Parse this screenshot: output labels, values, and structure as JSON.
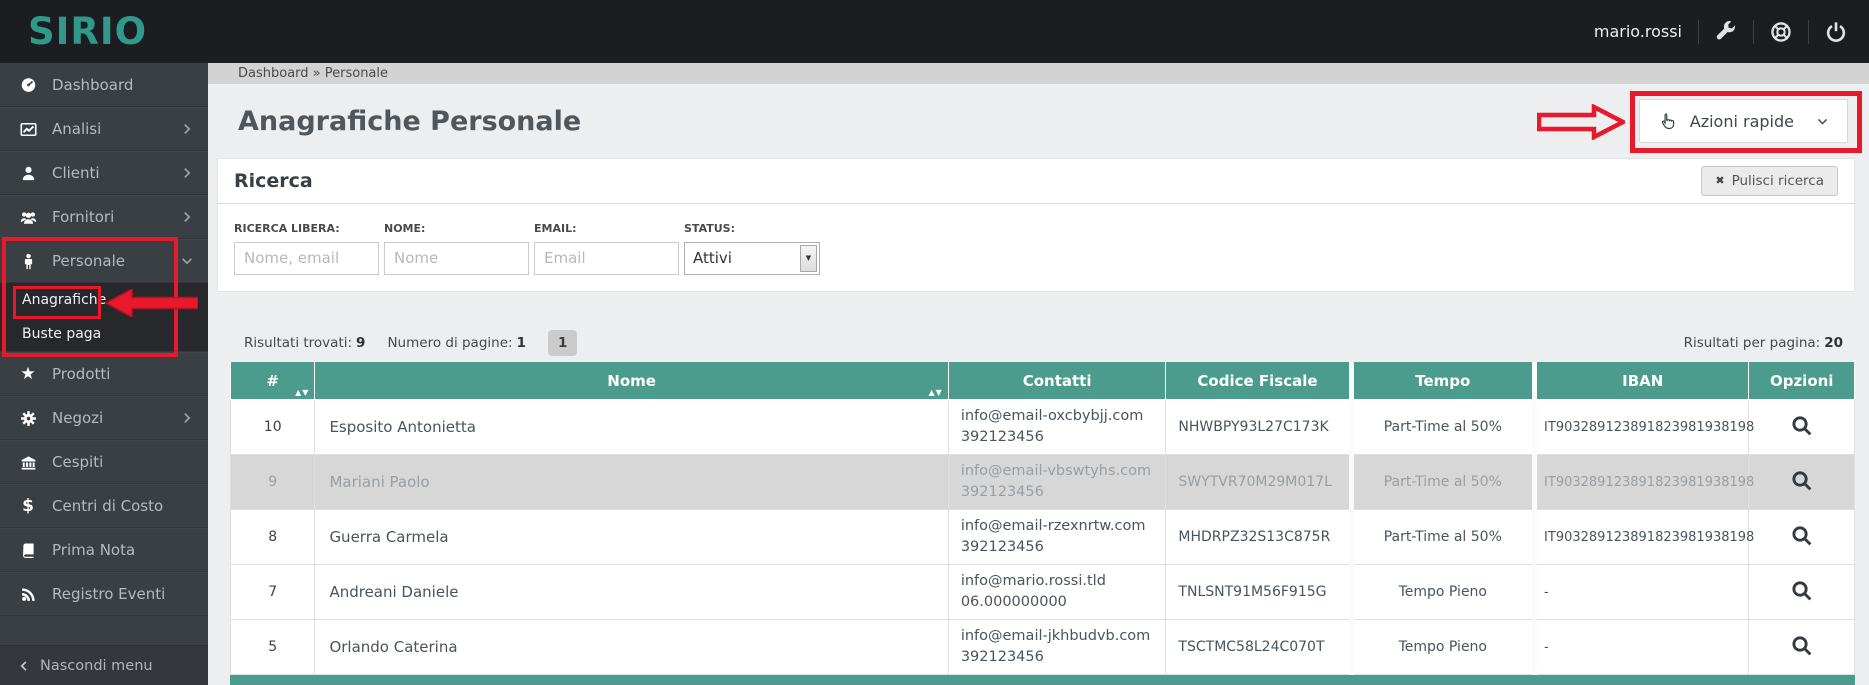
{
  "topbar": {
    "logo": "SIRIO",
    "username": "mario.rossi",
    "icons": [
      "wrench-icon",
      "help-icon",
      "power-icon"
    ]
  },
  "sidebar": {
    "items": [
      {
        "label": "Dashboard",
        "slug": "dashboard",
        "icon": "dashboard-icon"
      },
      {
        "label": "Analisi",
        "slug": "analisi",
        "icon": "chart-icon",
        "chevron": "right"
      },
      {
        "label": "Clienti",
        "slug": "clienti",
        "icon": "user-icon",
        "chevron": "right"
      },
      {
        "label": "Fornitori",
        "slug": "fornitori",
        "icon": "users-icon",
        "chevron": "right"
      },
      {
        "label": "Personale",
        "slug": "personale",
        "icon": "person-icon",
        "chevron": "down",
        "expanded": true,
        "children": [
          {
            "label": "Anagrafiche",
            "slug": "anagrafiche",
            "active": true
          },
          {
            "label": "Buste paga",
            "slug": "buste-paga"
          }
        ]
      },
      {
        "label": "Prodotti",
        "slug": "prodotti",
        "icon": "star-icon"
      },
      {
        "label": "Negozi",
        "slug": "negozi",
        "icon": "gear-icon",
        "chevron": "right"
      },
      {
        "label": "Cespiti",
        "slug": "cespiti",
        "icon": "bank-icon"
      },
      {
        "label": "Centri di Costo",
        "slug": "centri-di-costo",
        "icon": "dollar-icon"
      },
      {
        "label": "Prima Nota",
        "slug": "prima-nota",
        "icon": "book-icon"
      },
      {
        "label": "Registro Eventi",
        "slug": "registro-eventi",
        "icon": "rss-icon"
      }
    ],
    "collapse_label": "Nascondi menu"
  },
  "breadcrumb": {
    "text": "Dashboard » Personale"
  },
  "page": {
    "title": "Anagrafiche Personale",
    "quick_actions_label": "Azioni rapide"
  },
  "search": {
    "title": "Ricerca",
    "clear_label": "Pulisci ricerca",
    "free": {
      "label": "RICERCA LIBERA:",
      "placeholder": "Nome, email"
    },
    "nome": {
      "label": "NOME:",
      "placeholder": "Nome"
    },
    "email": {
      "label": "EMAIL:",
      "placeholder": "Email"
    },
    "status": {
      "label": "STATUS:",
      "value": "Attivi"
    }
  },
  "results": {
    "found_label": "Risultati trovati:",
    "found_value": "9",
    "pages_label": "Numero di pagine:",
    "pages_value": "1",
    "page_badge": "1",
    "per_page_label": "Risultati per pagina:",
    "per_page_value": "20"
  },
  "table": {
    "columns": [
      {
        "label": "#",
        "sortable": true
      },
      {
        "label": "Nome",
        "sortable": true
      },
      {
        "label": "Contatti",
        "sortable": false
      },
      {
        "label": "Codice Fiscale",
        "sortable": false
      },
      {
        "label": "Tempo",
        "sortable": false
      },
      {
        "label": "IBAN",
        "sortable": false
      },
      {
        "label": "Opzioni",
        "sortable": false
      }
    ],
    "rows": [
      {
        "id": "10",
        "nome": "Esposito Antonietta",
        "email": "info@email-oxcbybjj.com",
        "telefono": "392123456",
        "codice_fiscale": "NHWBPY93L27C173K",
        "tempo": "Part-Time al 50%",
        "iban": "IT903289123891823981938198",
        "inactive": false
      },
      {
        "id": "9",
        "nome": "Mariani Paolo",
        "email": "info@email-vbswtyhs.com",
        "telefono": "392123456",
        "codice_fiscale": "SWYTVR70M29M017L",
        "tempo": "Part-Time al 50%",
        "iban": "IT903289123891823981938198",
        "inactive": true
      },
      {
        "id": "8",
        "nome": "Guerra Carmela",
        "email": "info@email-rzexnrtw.com",
        "telefono": "392123456",
        "codice_fiscale": "MHDRPZ32S13C875R",
        "tempo": "Part-Time al 50%",
        "iban": "IT903289123891823981938198",
        "inactive": false
      },
      {
        "id": "7",
        "nome": "Andreani Daniele",
        "email": "info@mario.rossi.tld",
        "telefono": "06.000000000",
        "codice_fiscale": "TNLSNT91M56F915G",
        "tempo": "Tempo Pieno",
        "iban": "-",
        "inactive": false
      },
      {
        "id": "5",
        "nome": "Orlando Caterina",
        "email": "info@email-jkhbudvb.com",
        "telefono": "392123456",
        "codice_fiscale": "TSCTMC58L24C070T",
        "tempo": "Tempo Pieno",
        "iban": "-",
        "inactive": false
      }
    ]
  },
  "colors": {
    "teal": "#4c9c8e",
    "annotation_red": "#e8192c",
    "topbar_bg": "#1b1d21",
    "sidebar_bg": "#3a3f44"
  },
  "annotations": {
    "color": "#e8192c",
    "targets": [
      "sidebar-item-personale",
      "sidebar-subitem-anagrafiche",
      "quick-actions-button"
    ]
  }
}
